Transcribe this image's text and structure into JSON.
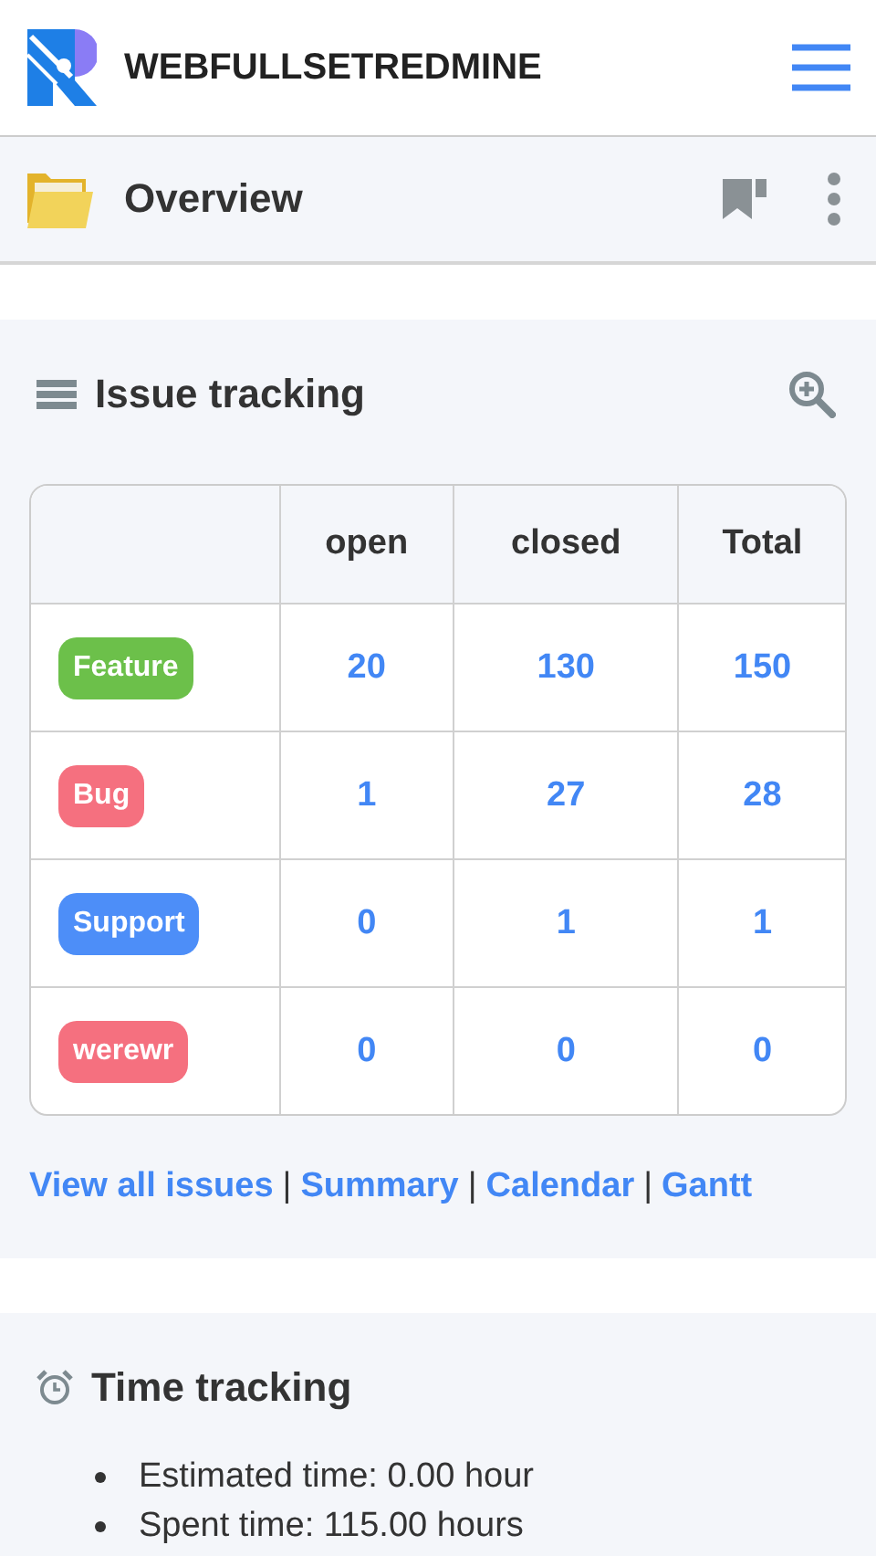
{
  "header": {
    "title": "WEBFULLSETREDMINE"
  },
  "page": {
    "title": "Overview"
  },
  "issue_tracking": {
    "title": "Issue tracking",
    "columns": [
      "open",
      "closed",
      "Total"
    ],
    "rows": [
      {
        "tracker": "Feature",
        "color": "#6cc04a",
        "open": "20",
        "closed": "130",
        "total": "150"
      },
      {
        "tracker": "Bug",
        "color": "#f5707f",
        "open": "1",
        "closed": "27",
        "total": "28"
      },
      {
        "tracker": "Support",
        "color": "#4d8ef8",
        "open": "0",
        "closed": "1",
        "total": "1"
      },
      {
        "tracker": "werewr",
        "color": "#f5707f",
        "open": "0",
        "closed": "0",
        "total": "0"
      }
    ],
    "links": [
      "View all issues",
      "Summary",
      "Calendar",
      "Gantt"
    ],
    "separator": "|"
  },
  "time_tracking": {
    "title": "Time tracking",
    "items": [
      "Estimated time: 0.00 hour",
      "Spent time: 115.00 hours"
    ]
  }
}
